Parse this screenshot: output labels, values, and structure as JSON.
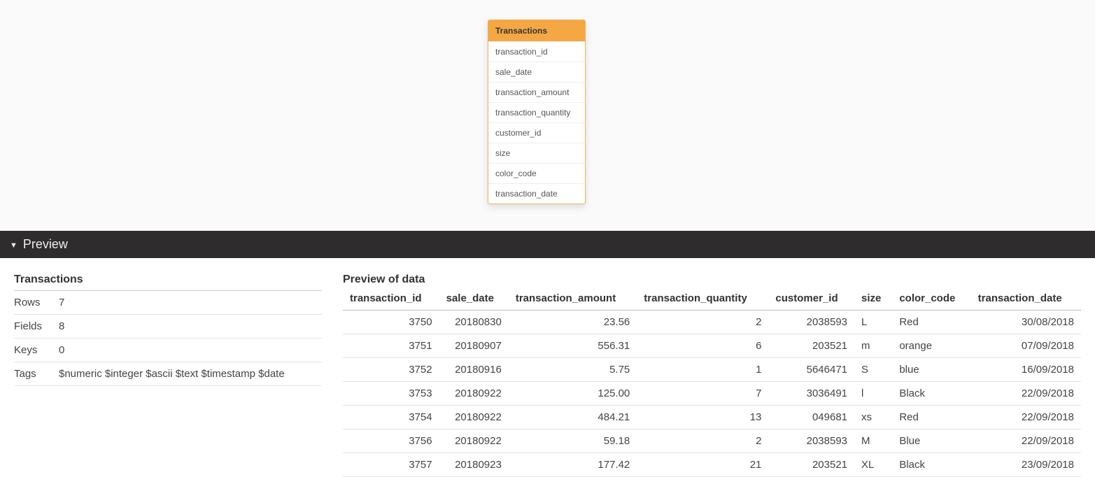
{
  "tableCard": {
    "title": "Transactions",
    "fields": [
      "transaction_id",
      "sale_date",
      "transaction_amount",
      "transaction_quantity",
      "customer_id",
      "size",
      "color_code",
      "transaction_date"
    ]
  },
  "previewBar": {
    "label": "Preview"
  },
  "meta": {
    "title": "Transactions",
    "rowsLabel": "Rows",
    "rowsValue": "7",
    "fieldsLabel": "Fields",
    "fieldsValue": "8",
    "keysLabel": "Keys",
    "keysValue": "0",
    "tagsLabel": "Tags",
    "tagsValue": "$numeric $integer $ascii $text $timestamp $date"
  },
  "dataPreview": {
    "title": "Preview of data",
    "columns": [
      {
        "label": "transaction_id",
        "align": "num"
      },
      {
        "label": "sale_date",
        "align": "num"
      },
      {
        "label": "transaction_amount",
        "align": "num"
      },
      {
        "label": "transaction_quantity",
        "align": "num"
      },
      {
        "label": "customer_id",
        "align": "num"
      },
      {
        "label": "size",
        "align": "txt"
      },
      {
        "label": "color_code",
        "align": "txt"
      },
      {
        "label": "transaction_date",
        "align": "num"
      }
    ],
    "rows": [
      [
        "3750",
        "20180830",
        "23.56",
        "2",
        "2038593",
        "L",
        "Red",
        "30/08/2018"
      ],
      [
        "3751",
        "20180907",
        "556.31",
        "6",
        "203521",
        "m",
        "orange",
        "07/09/2018"
      ],
      [
        "3752",
        "20180916",
        "5.75",
        "1",
        "5646471",
        "S",
        "blue",
        "16/09/2018"
      ],
      [
        "3753",
        "20180922",
        "125.00",
        "7",
        "3036491",
        "l",
        "Black",
        "22/09/2018"
      ],
      [
        "3754",
        "20180922",
        "484.21",
        "13",
        "049681",
        "xs",
        "Red",
        "22/09/2018"
      ],
      [
        "3756",
        "20180922",
        "59.18",
        "2",
        "2038593",
        "M",
        "Blue",
        "22/09/2018"
      ],
      [
        "3757",
        "20180923",
        "177.42",
        "21",
        "203521",
        "XL",
        "Black",
        "23/09/2018"
      ]
    ]
  }
}
